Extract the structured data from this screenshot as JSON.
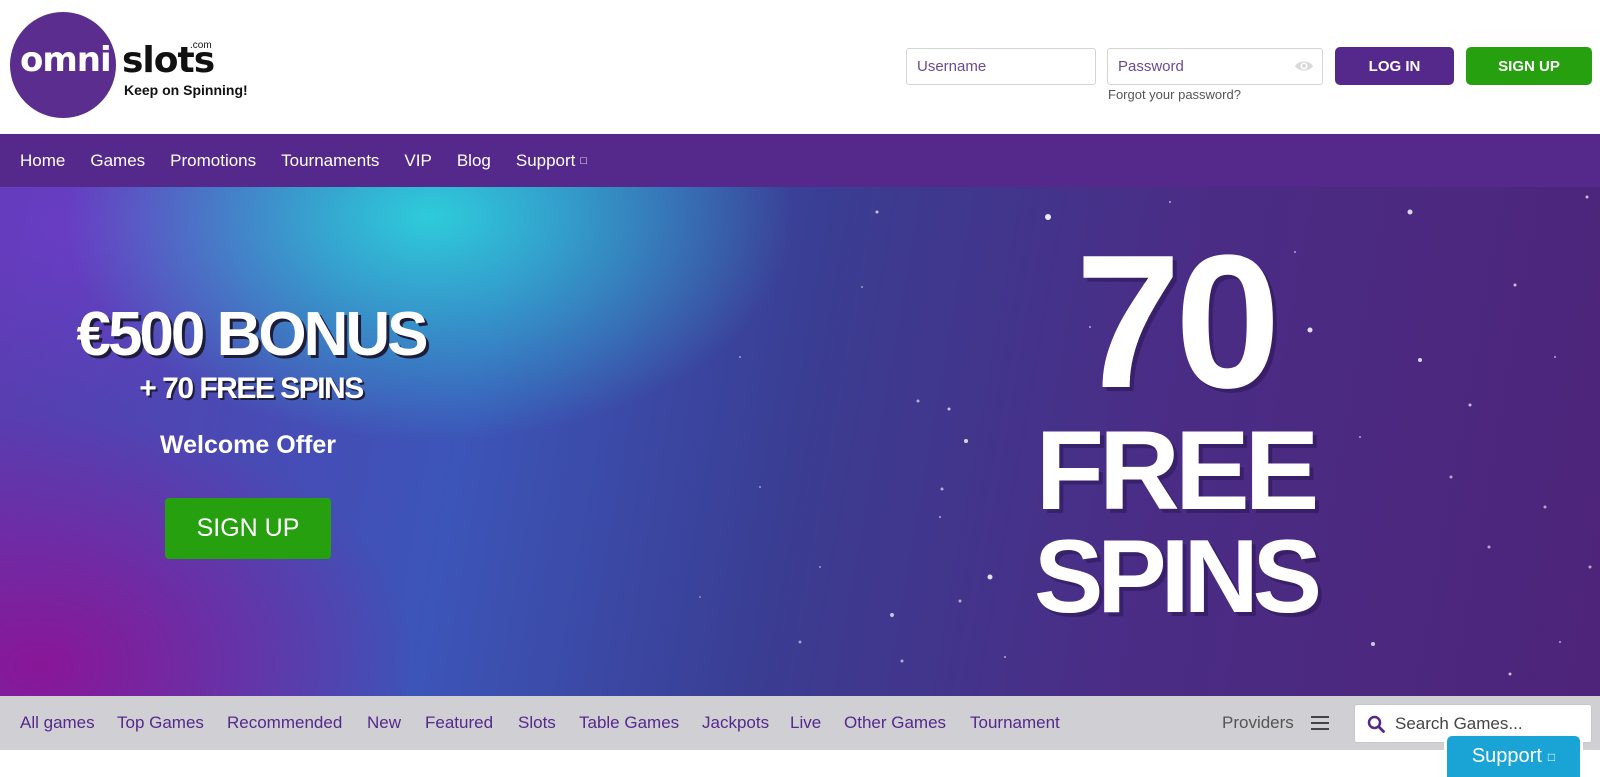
{
  "header": {
    "logo": {
      "omni": "omni",
      "slots": "slots",
      "com": ".com",
      "tagline": "Keep on Spinning!"
    },
    "username_placeholder": "Username",
    "password_placeholder": "Password",
    "forgot_label": "Forgot your password?",
    "login_label": "LOG IN",
    "signup_label": "SIGN UP",
    "password_toggle_icon": "eye-icon"
  },
  "mainnav": {
    "items": [
      "Home",
      "Games",
      "Promotions",
      "Tournaments",
      "VIP",
      "Blog"
    ],
    "support_label": "Support",
    "support_caret": "□"
  },
  "hero": {
    "bonus": "€500 BONUS",
    "spins": "+ 70 FREE SPINS",
    "welcome": "Welcome Offer",
    "signup_label": "SIGN UP",
    "big_number": "70",
    "big_free": "FREE",
    "big_spins": "SPINS"
  },
  "gamesnav": {
    "categories": [
      "All games",
      "Top Games",
      "Recommended",
      "New",
      "Featured",
      "Slots",
      "Table Games",
      "Jackpots",
      "Live",
      "Other Games",
      "Tournament"
    ],
    "providers_label": "Providers",
    "menu_icon": "hamburger-icon",
    "search_placeholder": "Search Games...",
    "search_icon": "search-icon"
  },
  "support_widget": {
    "label": "Support",
    "caret": "□"
  },
  "colors": {
    "brand_purple": "#55288b",
    "signup_green": "#27a010",
    "support_blue": "#1aa4d6"
  }
}
